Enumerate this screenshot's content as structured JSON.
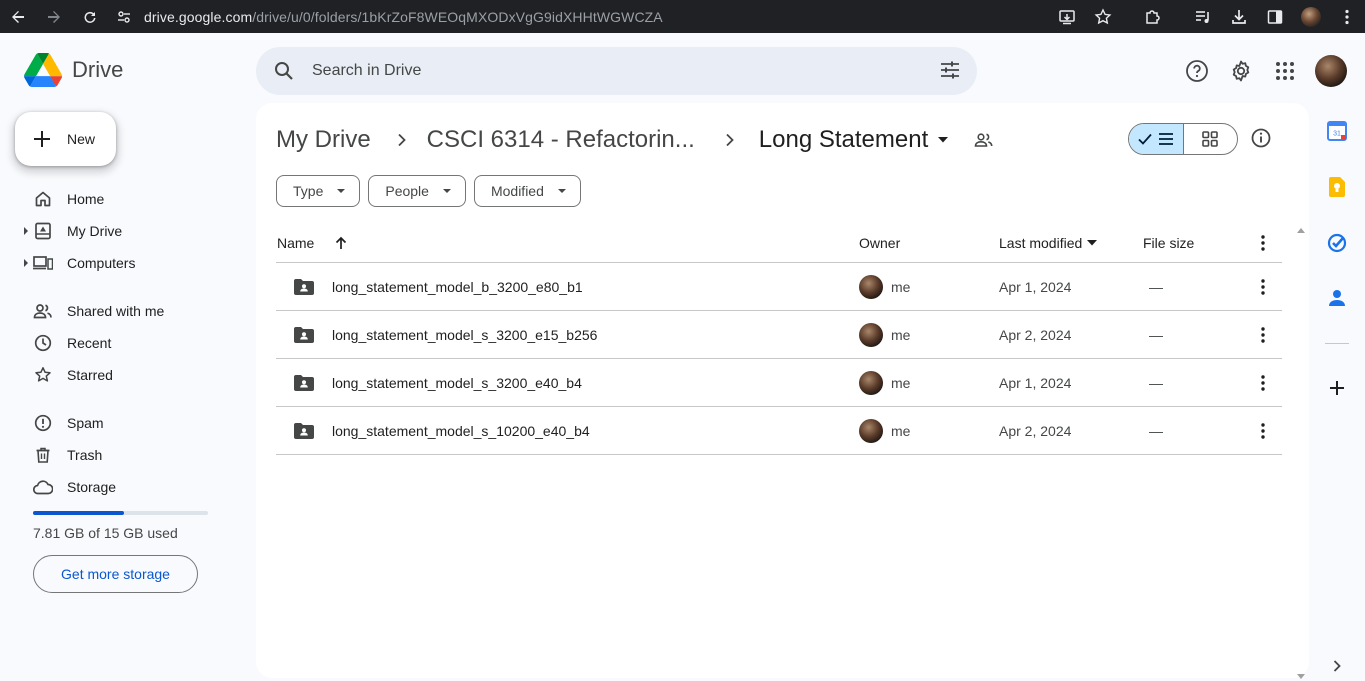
{
  "browser": {
    "url_host": "drive.google.com",
    "url_path": "/drive/u/0/folders/1bKrZoF8WEOqMXODxVgG9idXHHtWGWCZA"
  },
  "app": {
    "name": "Drive"
  },
  "search": {
    "placeholder": "Search in Drive"
  },
  "new_button": {
    "label": "New"
  },
  "nav": {
    "home": "Home",
    "my_drive": "My Drive",
    "computers": "Computers",
    "shared": "Shared with me",
    "recent": "Recent",
    "starred": "Starred",
    "spam": "Spam",
    "trash": "Trash",
    "storage": "Storage"
  },
  "storage": {
    "used_text": "7.81 GB of 15 GB used",
    "used_fraction": 0.52,
    "button_label": "Get more storage"
  },
  "breadcrumb": {
    "root": "My Drive",
    "parent": "CSCI 6314 - Refactorin...",
    "current": "Long Statement"
  },
  "filters": {
    "type": "Type",
    "people": "People",
    "modified": "Modified"
  },
  "table": {
    "headers": {
      "name": "Name",
      "owner": "Owner",
      "modified": "Last modified",
      "size": "File size"
    },
    "rows": [
      {
        "name": "long_statement_model_b_3200_e80_b1",
        "owner": "me",
        "modified": "Apr 1, 2024",
        "size": "—"
      },
      {
        "name": "long_statement_model_s_3200_e15_b256",
        "owner": "me",
        "modified": "Apr 2, 2024",
        "size": "—"
      },
      {
        "name": "long_statement_model_s_3200_e40_b4",
        "owner": "me",
        "modified": "Apr 1, 2024",
        "size": "—"
      },
      {
        "name": "long_statement_model_s_10200_e40_b4",
        "owner": "me",
        "modified": "Apr 2, 2024",
        "size": "—"
      }
    ]
  },
  "side_panel": {
    "calendar_day": "31"
  },
  "colors": {
    "accent": "#0b57d0",
    "toggle_active": "#c2e7ff",
    "search_bg": "#e9eef6",
    "page_bg": "#f8fafd"
  }
}
